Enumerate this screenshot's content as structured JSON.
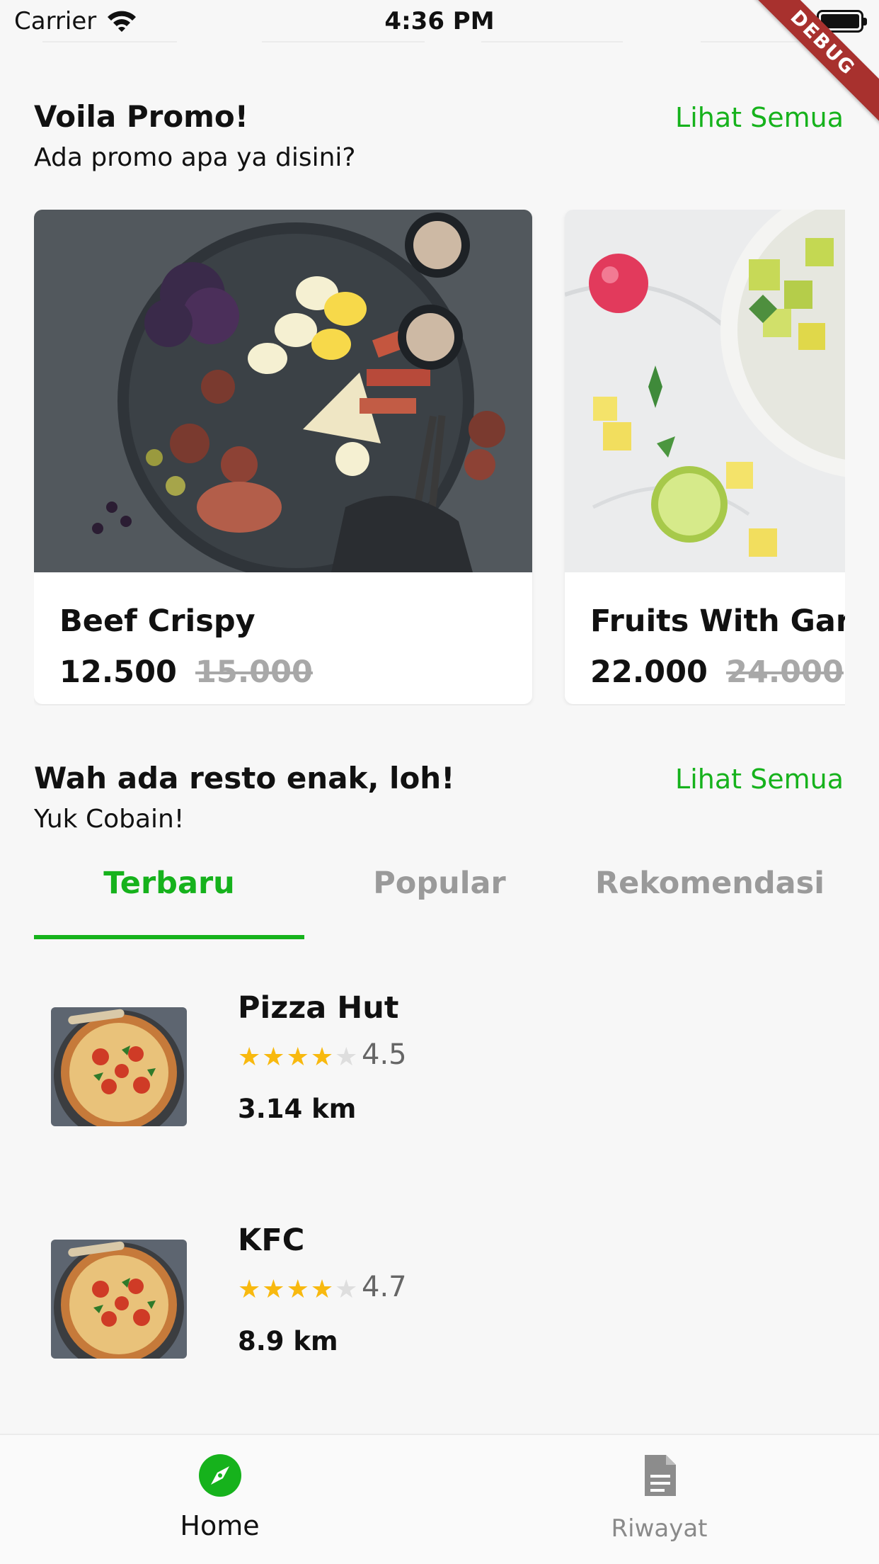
{
  "status_bar": {
    "carrier": "Carrier",
    "time": "4:36 PM"
  },
  "debug_banner": "DEBUG",
  "promo_section": {
    "title": "Voila Promo!",
    "subtitle": "Ada promo apa ya disini?",
    "see_all": "Lihat Semua",
    "cards": [
      {
        "name": "Beef Crispy",
        "price": "12.500",
        "old_price": "15.000"
      },
      {
        "name": "Fruits With Garlic",
        "price": "22.000",
        "old_price": "24.000"
      }
    ]
  },
  "resto_section": {
    "title": "Wah ada resto enak, loh!",
    "subtitle": "Yuk Cobain!",
    "see_all": "Lihat Semua",
    "tabs": [
      {
        "label": "Terbaru",
        "active": true
      },
      {
        "label": "Popular",
        "active": false
      },
      {
        "label": "Rekomendasi",
        "active": false
      }
    ],
    "restaurants": [
      {
        "name": "Pizza Hut",
        "stars": 4,
        "rating": "4.5",
        "distance": "3.14 km"
      },
      {
        "name": "KFC",
        "stars": 4,
        "rating": "4.7",
        "distance": "8.9 km"
      }
    ]
  },
  "bottom_nav": {
    "items": [
      {
        "label": "Home",
        "icon": "compass-icon",
        "active": true
      },
      {
        "label": "Riwayat",
        "icon": "document-icon",
        "active": false
      }
    ]
  },
  "colors": {
    "accent": "#16b21c",
    "star": "#f8b90f",
    "inactive": "#9a9a9a",
    "debug": "#a8312e"
  }
}
